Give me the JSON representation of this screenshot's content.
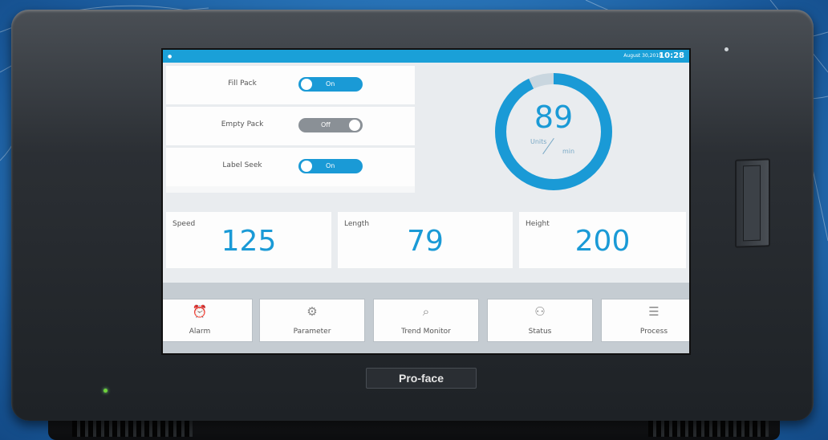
{
  "status_bar": {
    "indicator": "●",
    "date": "August 30,2019",
    "time": "10:28"
  },
  "toggles": [
    {
      "label": "Fill Pack",
      "state": "On",
      "on": true
    },
    {
      "label": "Empty Pack",
      "state": "Off",
      "on": false
    },
    {
      "label": "Label Seek",
      "state": "On",
      "on": true
    }
  ],
  "gauge": {
    "value": "89",
    "fill_fraction": 0.93,
    "unit_top": "Units",
    "unit_bottom": "min",
    "color": "#1a9ad6"
  },
  "readouts": [
    {
      "label": "Speed",
      "value": "125"
    },
    {
      "label": "Length",
      "value": "79"
    },
    {
      "label": "Height",
      "value": "200"
    }
  ],
  "nav": [
    {
      "label": "Alarm",
      "icon": "alarm-clock-icon",
      "glyph": "⏰"
    },
    {
      "label": "Parameter",
      "icon": "gears-icon",
      "glyph": "⚙"
    },
    {
      "label": "Trend Monitor",
      "icon": "magnifier-icon",
      "glyph": "⌕"
    },
    {
      "label": "Status",
      "icon": "binoculars-icon",
      "glyph": "⚇"
    },
    {
      "label": "Process",
      "icon": "flowchart-icon",
      "glyph": "☰"
    }
  ],
  "brand": "Pro-face"
}
